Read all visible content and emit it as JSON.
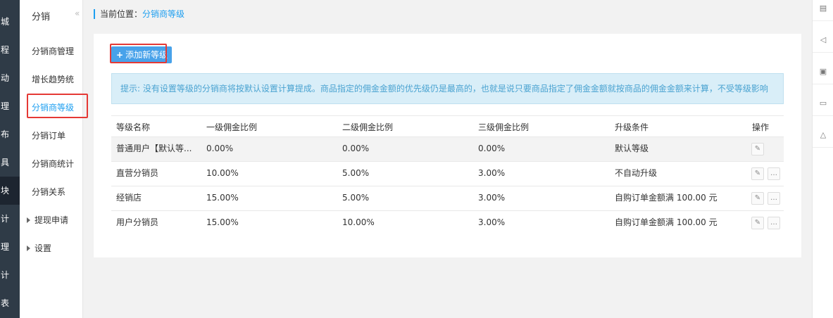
{
  "left_nav": {
    "items": [
      "城",
      "程",
      "动",
      "理",
      "布",
      "具",
      "块",
      "计",
      "理",
      "计",
      "表"
    ],
    "active_index": 6
  },
  "sub_nav": {
    "title": "分销",
    "collapse_icon": "«",
    "items": [
      "分销商管理",
      "增长趋势统",
      "分销商等级",
      "分销订单",
      "分销商统计",
      "分销关系"
    ],
    "current_index": 2,
    "groups": [
      "提现申请",
      "设置"
    ]
  },
  "breadcrumb": {
    "prefix": "当前位置：",
    "current": "分销商等级",
    "accent": "#1e9ff0"
  },
  "add_button": {
    "label": "添加新等级",
    "icon": "plus-icon"
  },
  "tip": "提示: 没有设置等级的分销商将按默认设置计算提成。商品指定的佣金金额的优先级仍是最高的，也就是说只要商品指定了佣金金额就按商品的佣金金额来计算，不受等级影响",
  "table": {
    "headers": [
      "等级名称",
      "一级佣金比例",
      "二级佣金比例",
      "三级佣金比例",
      "升级条件",
      "操作"
    ],
    "rows": [
      {
        "name": "普通用户【默认等...",
        "l1": "0.00%",
        "l2": "0.00%",
        "l3": "0.00%",
        "cond": "默认等级",
        "ops": [
          "edit"
        ]
      },
      {
        "name": "直营分销员",
        "l1": "10.00%",
        "l2": "5.00%",
        "l3": "3.00%",
        "cond": "不自动升级",
        "ops": [
          "edit",
          "more"
        ]
      },
      {
        "name": "经销店",
        "l1": "15.00%",
        "l2": "5.00%",
        "l3": "3.00%",
        "cond": "自购订单金额满 100.00 元",
        "ops": [
          "edit",
          "more"
        ]
      },
      {
        "name": "用户分销员",
        "l1": "15.00%",
        "l2": "10.00%",
        "l3": "3.00%",
        "cond": "自购订单金额满 100.00 元",
        "ops": [
          "edit",
          "more"
        ]
      }
    ]
  },
  "right_toolbar": [
    "document-icon",
    "speaker-icon",
    "edit-note-icon",
    "message-icon",
    "bell-icon"
  ],
  "highlight_color": "#e53935"
}
